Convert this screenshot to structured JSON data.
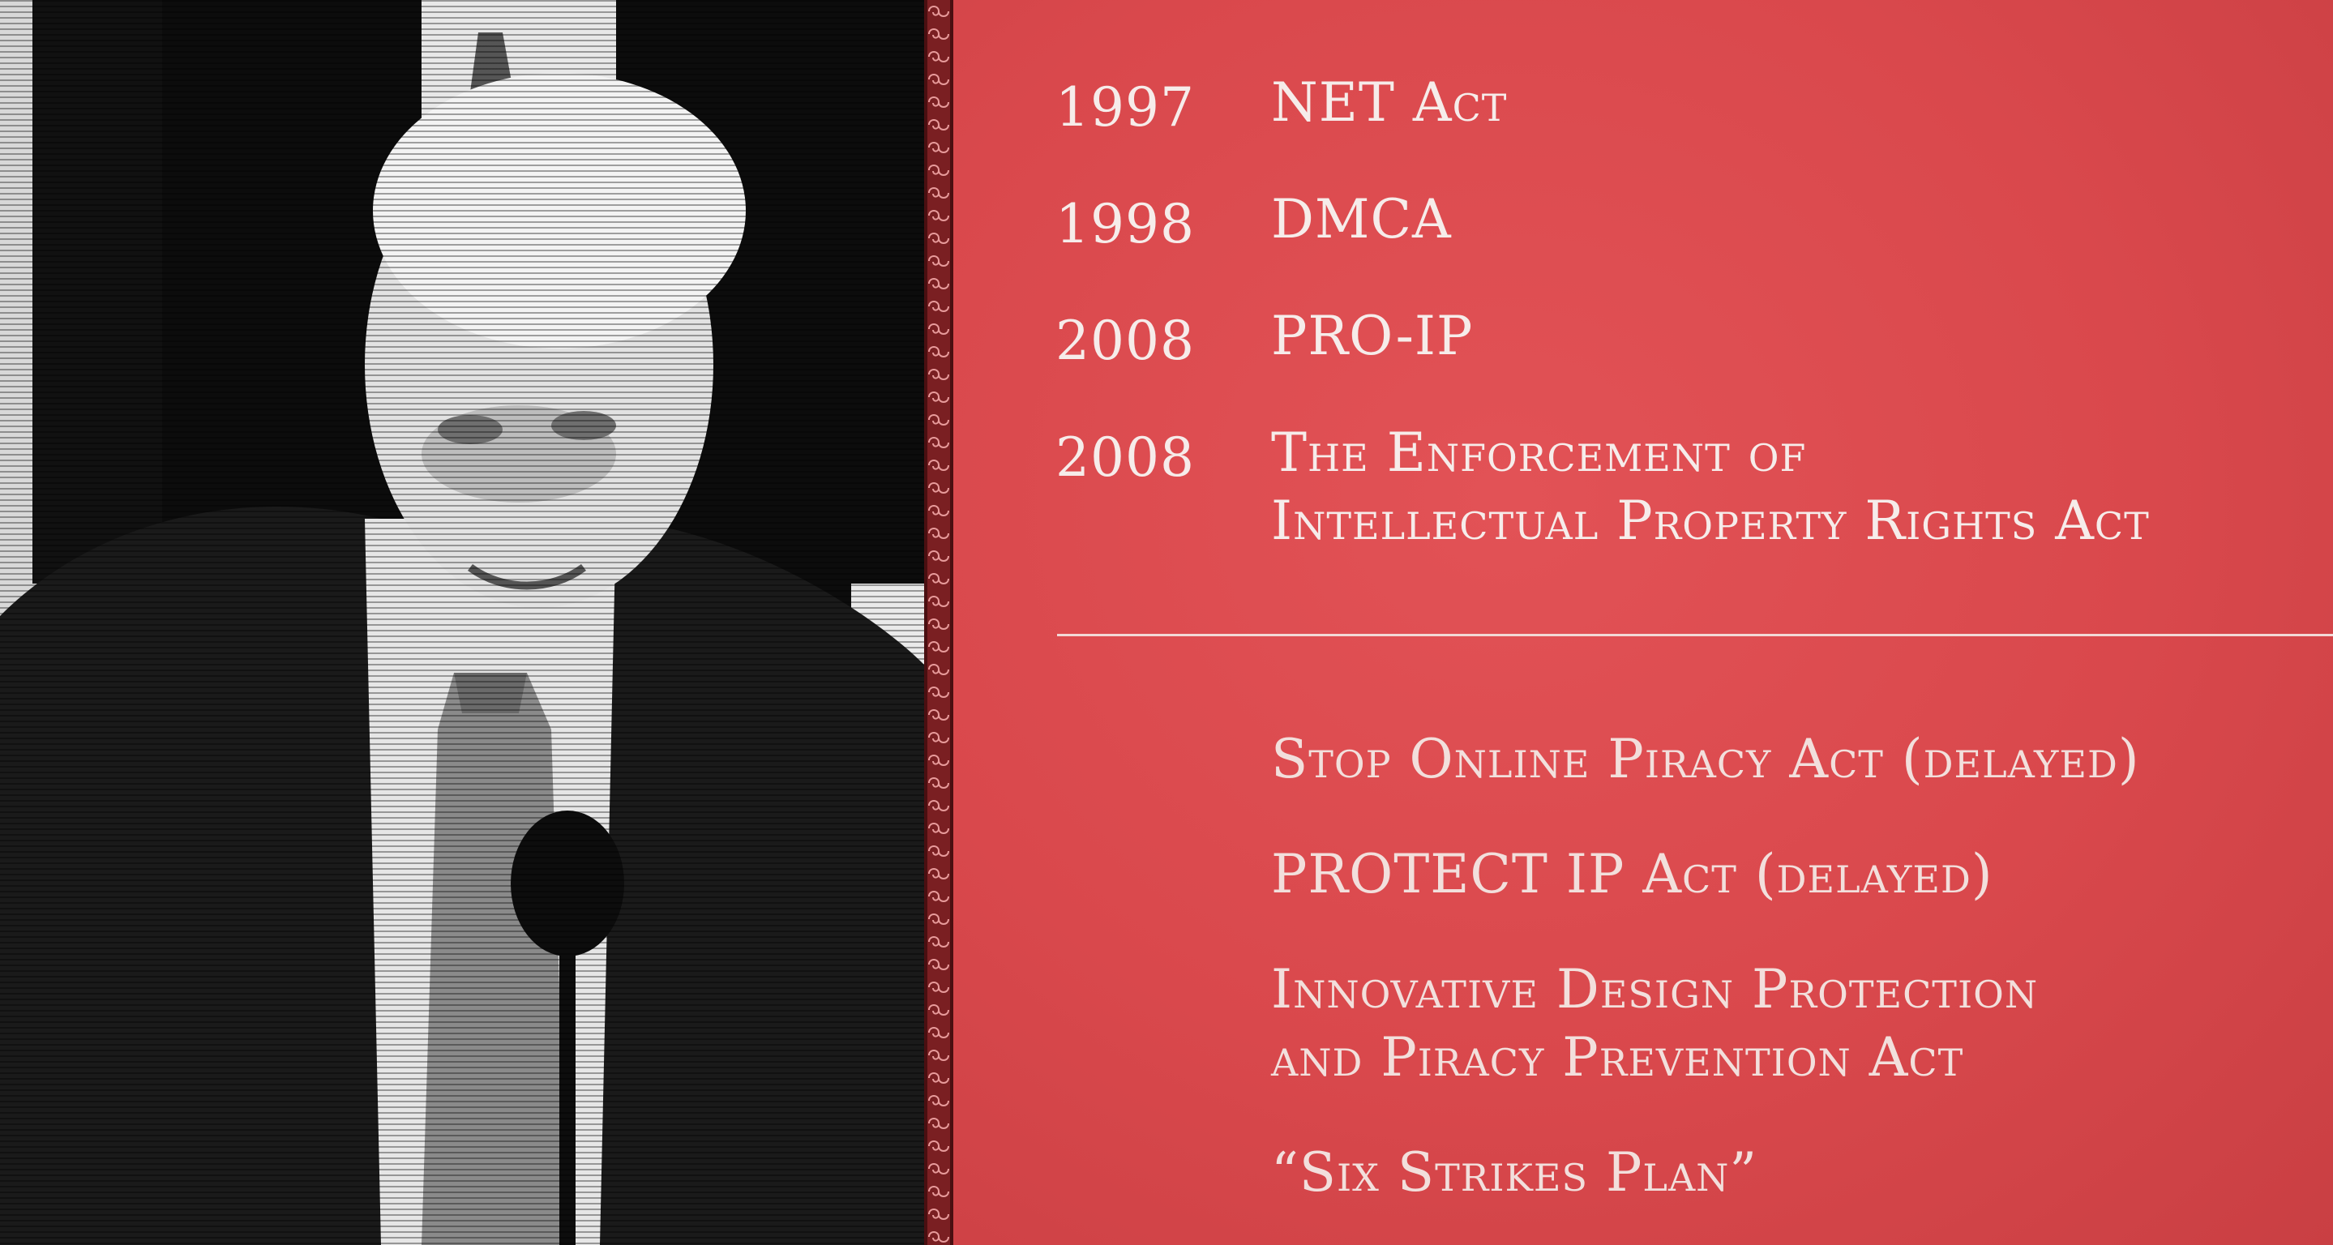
{
  "enacted": [
    {
      "year": "1997",
      "title": "NET Act"
    },
    {
      "year": "1998",
      "title": "DMCA"
    },
    {
      "year": "2008",
      "title": "PRO-IP"
    },
    {
      "year": "2008",
      "title_line1": "The Enforcement of",
      "title_line2": "Intellectual Property Rights Act"
    }
  ],
  "proposed": [
    {
      "title": "Stop Online Piracy Act (delayed)"
    },
    {
      "title": "PROTECT IP Act (delayed)"
    },
    {
      "title_line1": "Innovative Design Protection",
      "title_line2": "and Piracy Prevention Act"
    },
    {
      "title": "“Six Strikes Plan”"
    }
  ],
  "colors": {
    "panel_red": "#d9484c",
    "text": "#f6ecea",
    "border_red": "#7a1f22"
  }
}
